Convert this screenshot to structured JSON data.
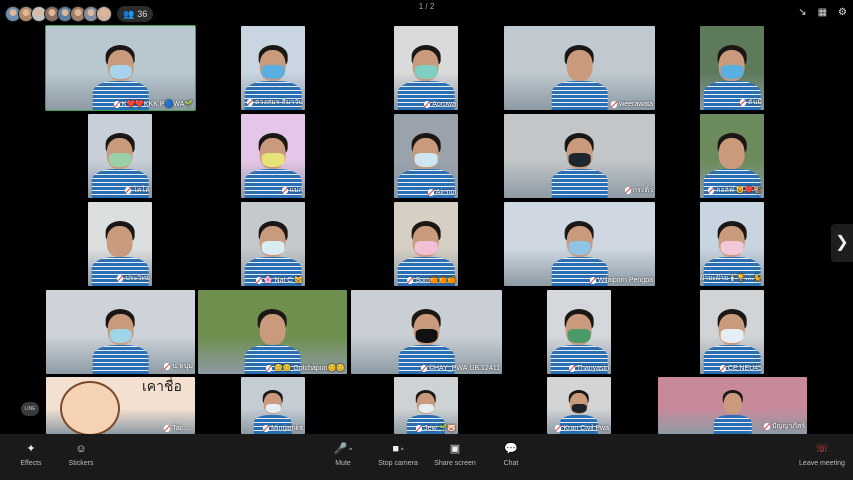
{
  "topbar": {
    "participant_count": "36",
    "page_indicator": "1 / 2",
    "avatar_colors": [
      "#6a8fb0",
      "#b08a6a",
      "#c2c2c2",
      "#8c6f60",
      "#5a7f9f",
      "#9f7f6a",
      "#7f8f9f",
      "#d0b0a0"
    ]
  },
  "tiles": [
    {
      "name": "K❤️❤️KKK P🔵WA🌱",
      "active": true,
      "bg": "#b9c7cf",
      "mask": "#a8d3ee"
    },
    {
      "name": "ดวงสมร สีมาวัน",
      "bg": "#c9d6e2",
      "mask": "#5aaee0"
    },
    {
      "name": "Aorpwa",
      "bg": "#d8dadb",
      "mask": "#7fd0c0"
    },
    {
      "name": "weerawata",
      "bg": "#bfc9cf",
      "mask": ""
    },
    {
      "name": "ต้นมี",
      "bg": "#5d7a5a",
      "mask": "#5aaee0"
    },
    {
      "name": "โคโค้",
      "bg": "#c8cfd8",
      "mask": "#9ad0a8"
    },
    {
      "name": "แม่ก๋",
      "bg": "#e6c6e8",
      "mask": "#e8e27a"
    },
    {
      "name": "Air-noi",
      "bg": "#9aa2ac",
      "mask": "#cfe6f0"
    },
    {
      "name": "กระติ๋ว",
      "bg": "#c2c6c8",
      "mask": "#1e2630"
    },
    {
      "name": "กอล์ฟ 😺❤️🐒",
      "bg": "#6c8b5c",
      "mask": ""
    },
    {
      "name": "ประวิทย์",
      "bg": "#dcdfe0",
      "mask": ""
    },
    {
      "name": "🌸 Nat C 🐱",
      "bg": "#c4c9cc",
      "mask": "#d8ecf4"
    },
    {
      "name": "Som🍊🍊🍊",
      "bg": "#d6cfc4",
      "mask": "#f2c0d6"
    },
    {
      "name": "Wilaiporn Pengpa",
      "bg": "#cfd8e2",
      "mask": "#8ec4e6"
    },
    {
      "name": "ฝ้ายะฝ้าย🕯️🏆....🐈",
      "bg": "#c8d4df",
      "mask": "#f0c8d8"
    },
    {
      "name": "น.หนุ่ม",
      "bg": "#cdd3d8",
      "mask": "#a0d4e8"
    },
    {
      "name": "😊😊 Gotchapun😊😊",
      "bg": "#6e8f4e",
      "mask": ""
    },
    {
      "name": "©HAY_PWA.UB.12411",
      "bg": "#c9cfd4",
      "mask": "#111111"
    },
    {
      "name": "Thanyasiri",
      "bg": "#d4d8dc",
      "mask": "#4a9a6a"
    },
    {
      "name": "CE NEU45",
      "bg": "#d0d4d6",
      "mask": "#e6eef4"
    },
    {
      "name": "Tac.....",
      "bg": "#f4e0d0",
      "mask": ""
    },
    {
      "name": "Mintjamint",
      "bg": "#c4ccd4",
      "mask": "#e6eef4"
    },
    {
      "name": "Jew 🌱🐷",
      "bg": "#cfd2d4",
      "mask": "#e6eef4"
    },
    {
      "name": "Kran Civil Pwa",
      "bg": "#d2d4d6",
      "mask": "#1e2228"
    },
    {
      "name": "ปัญญาภัสร์",
      "bg": "#c88a9a",
      "mask": ""
    }
  ],
  "sticker_text": "เคาชื่อ",
  "side_badge": "LINE",
  "toolbar": {
    "effects": "Effects",
    "stickers": "Stickers",
    "mute": "Mute",
    "stop_camera": "Stop camera",
    "share_screen": "Share screen",
    "chat": "Chat",
    "leave_meeting": "Leave meeting"
  }
}
